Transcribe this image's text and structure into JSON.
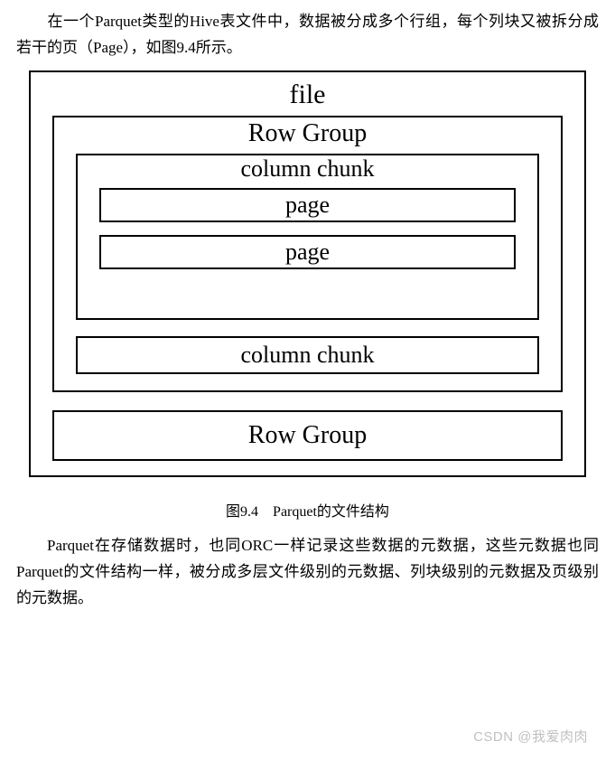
{
  "para1": "在一个Parquet类型的Hive表文件中，数据被分成多个行组，每个列块又被拆分成若干的页（Page），如图9.4所示。",
  "figure": {
    "file": "file",
    "rowgroup1": "Row Group",
    "colchunk1": "column chunk",
    "page1": "page",
    "page2": "page",
    "colchunk2": "column chunk",
    "rowgroup2": "Row Group"
  },
  "caption": "图9.4　Parquet的文件结构",
  "para2": "Parquet在存储数据时，也同ORC一样记录这些数据的元数据，这些元数据也同Parquet的文件结构一样，被分成多层文件级别的元数据、列块级别的元数据及页级别的元数据。",
  "watermark": "CSDN @我爱肉肉"
}
